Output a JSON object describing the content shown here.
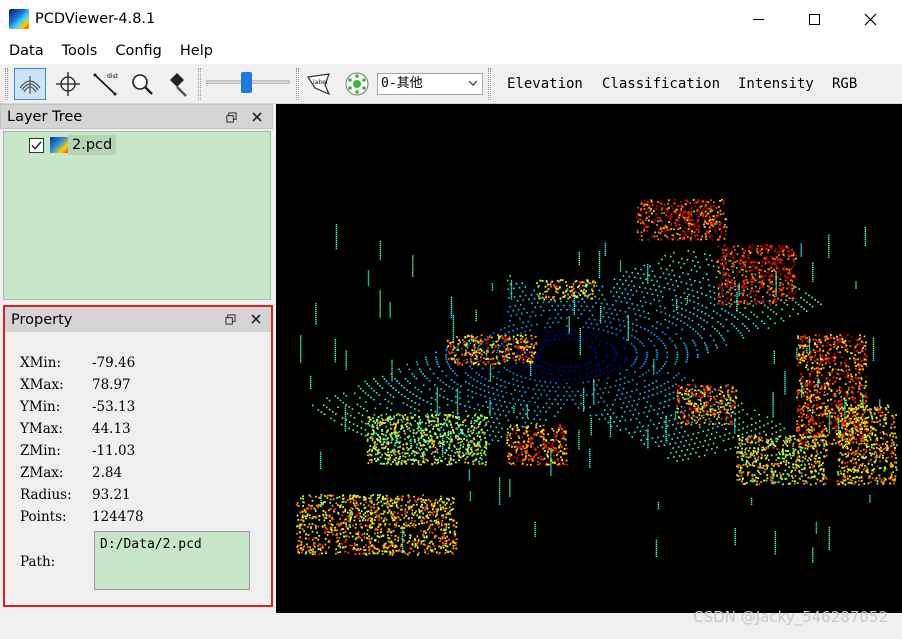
{
  "window": {
    "title": "PCDViewer-4.8.1"
  },
  "menu": {
    "items": [
      "Data",
      "Tools",
      "Config",
      "Help"
    ]
  },
  "toolbar": {
    "combo_value": "0-其他",
    "color_modes": [
      "Elevation",
      "Classification",
      "Intensity",
      "RGB"
    ],
    "slider_value_percent": 45,
    "label_tool_text": "label",
    "dist_tool_text": "dist"
  },
  "layer_tree": {
    "title": "Layer Tree",
    "items": [
      {
        "label": "2.pcd",
        "checked": true
      }
    ]
  },
  "property": {
    "title": "Property",
    "rows": [
      {
        "key": "XMin:",
        "value": "-79.46"
      },
      {
        "key": "XMax:",
        "value": "78.97"
      },
      {
        "key": "YMin:",
        "value": "-53.13"
      },
      {
        "key": "YMax:",
        "value": "44.13"
      },
      {
        "key": "ZMin:",
        "value": "-11.03"
      },
      {
        "key": "ZMax:",
        "value": "2.84"
      },
      {
        "key": "Radius:",
        "value": "93.21"
      },
      {
        "key": "Points:",
        "value": "124478"
      }
    ],
    "path_label": "Path:",
    "path_value": "D:/Data/2.pcd"
  },
  "watermark": "CSDN @Jacky_546287052",
  "colors": {
    "highlight_border": "#e02020",
    "panel_green": "#c8e6c9",
    "viewport_bg": "#000000",
    "accent_blue": "#1f7ae0"
  }
}
